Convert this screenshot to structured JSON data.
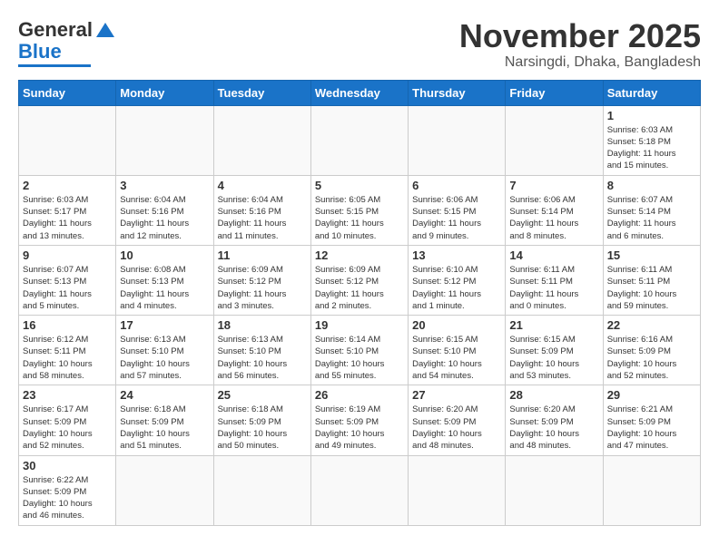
{
  "header": {
    "logo_general": "General",
    "logo_blue": "Blue",
    "title": "November 2025",
    "subtitle": "Narsingdi, Dhaka, Bangladesh"
  },
  "weekdays": [
    "Sunday",
    "Monday",
    "Tuesday",
    "Wednesday",
    "Thursday",
    "Friday",
    "Saturday"
  ],
  "days": [
    {
      "num": "",
      "info": ""
    },
    {
      "num": "",
      "info": ""
    },
    {
      "num": "",
      "info": ""
    },
    {
      "num": "",
      "info": ""
    },
    {
      "num": "",
      "info": ""
    },
    {
      "num": "",
      "info": ""
    },
    {
      "num": "1",
      "info": "Sunrise: 6:03 AM\nSunset: 5:18 PM\nDaylight: 11 hours\nand 15 minutes."
    },
    {
      "num": "2",
      "info": "Sunrise: 6:03 AM\nSunset: 5:17 PM\nDaylight: 11 hours\nand 13 minutes."
    },
    {
      "num": "3",
      "info": "Sunrise: 6:04 AM\nSunset: 5:16 PM\nDaylight: 11 hours\nand 12 minutes."
    },
    {
      "num": "4",
      "info": "Sunrise: 6:04 AM\nSunset: 5:16 PM\nDaylight: 11 hours\nand 11 minutes."
    },
    {
      "num": "5",
      "info": "Sunrise: 6:05 AM\nSunset: 5:15 PM\nDaylight: 11 hours\nand 10 minutes."
    },
    {
      "num": "6",
      "info": "Sunrise: 6:06 AM\nSunset: 5:15 PM\nDaylight: 11 hours\nand 9 minutes."
    },
    {
      "num": "7",
      "info": "Sunrise: 6:06 AM\nSunset: 5:14 PM\nDaylight: 11 hours\nand 8 minutes."
    },
    {
      "num": "8",
      "info": "Sunrise: 6:07 AM\nSunset: 5:14 PM\nDaylight: 11 hours\nand 6 minutes."
    },
    {
      "num": "9",
      "info": "Sunrise: 6:07 AM\nSunset: 5:13 PM\nDaylight: 11 hours\nand 5 minutes."
    },
    {
      "num": "10",
      "info": "Sunrise: 6:08 AM\nSunset: 5:13 PM\nDaylight: 11 hours\nand 4 minutes."
    },
    {
      "num": "11",
      "info": "Sunrise: 6:09 AM\nSunset: 5:12 PM\nDaylight: 11 hours\nand 3 minutes."
    },
    {
      "num": "12",
      "info": "Sunrise: 6:09 AM\nSunset: 5:12 PM\nDaylight: 11 hours\nand 2 minutes."
    },
    {
      "num": "13",
      "info": "Sunrise: 6:10 AM\nSunset: 5:12 PM\nDaylight: 11 hours\nand 1 minute."
    },
    {
      "num": "14",
      "info": "Sunrise: 6:11 AM\nSunset: 5:11 PM\nDaylight: 11 hours\nand 0 minutes."
    },
    {
      "num": "15",
      "info": "Sunrise: 6:11 AM\nSunset: 5:11 PM\nDaylight: 10 hours\nand 59 minutes."
    },
    {
      "num": "16",
      "info": "Sunrise: 6:12 AM\nSunset: 5:11 PM\nDaylight: 10 hours\nand 58 minutes."
    },
    {
      "num": "17",
      "info": "Sunrise: 6:13 AM\nSunset: 5:10 PM\nDaylight: 10 hours\nand 57 minutes."
    },
    {
      "num": "18",
      "info": "Sunrise: 6:13 AM\nSunset: 5:10 PM\nDaylight: 10 hours\nand 56 minutes."
    },
    {
      "num": "19",
      "info": "Sunrise: 6:14 AM\nSunset: 5:10 PM\nDaylight: 10 hours\nand 55 minutes."
    },
    {
      "num": "20",
      "info": "Sunrise: 6:15 AM\nSunset: 5:10 PM\nDaylight: 10 hours\nand 54 minutes."
    },
    {
      "num": "21",
      "info": "Sunrise: 6:15 AM\nSunset: 5:09 PM\nDaylight: 10 hours\nand 53 minutes."
    },
    {
      "num": "22",
      "info": "Sunrise: 6:16 AM\nSunset: 5:09 PM\nDaylight: 10 hours\nand 52 minutes."
    },
    {
      "num": "23",
      "info": "Sunrise: 6:17 AM\nSunset: 5:09 PM\nDaylight: 10 hours\nand 52 minutes."
    },
    {
      "num": "24",
      "info": "Sunrise: 6:18 AM\nSunset: 5:09 PM\nDaylight: 10 hours\nand 51 minutes."
    },
    {
      "num": "25",
      "info": "Sunrise: 6:18 AM\nSunset: 5:09 PM\nDaylight: 10 hours\nand 50 minutes."
    },
    {
      "num": "26",
      "info": "Sunrise: 6:19 AM\nSunset: 5:09 PM\nDaylight: 10 hours\nand 49 minutes."
    },
    {
      "num": "27",
      "info": "Sunrise: 6:20 AM\nSunset: 5:09 PM\nDaylight: 10 hours\nand 48 minutes."
    },
    {
      "num": "28",
      "info": "Sunrise: 6:20 AM\nSunset: 5:09 PM\nDaylight: 10 hours\nand 48 minutes."
    },
    {
      "num": "29",
      "info": "Sunrise: 6:21 AM\nSunset: 5:09 PM\nDaylight: 10 hours\nand 47 minutes."
    },
    {
      "num": "30",
      "info": "Sunrise: 6:22 AM\nSunset: 5:09 PM\nDaylight: 10 hours\nand 46 minutes."
    },
    {
      "num": "",
      "info": ""
    },
    {
      "num": "",
      "info": ""
    },
    {
      "num": "",
      "info": ""
    },
    {
      "num": "",
      "info": ""
    },
    {
      "num": "",
      "info": ""
    },
    {
      "num": "",
      "info": ""
    }
  ]
}
